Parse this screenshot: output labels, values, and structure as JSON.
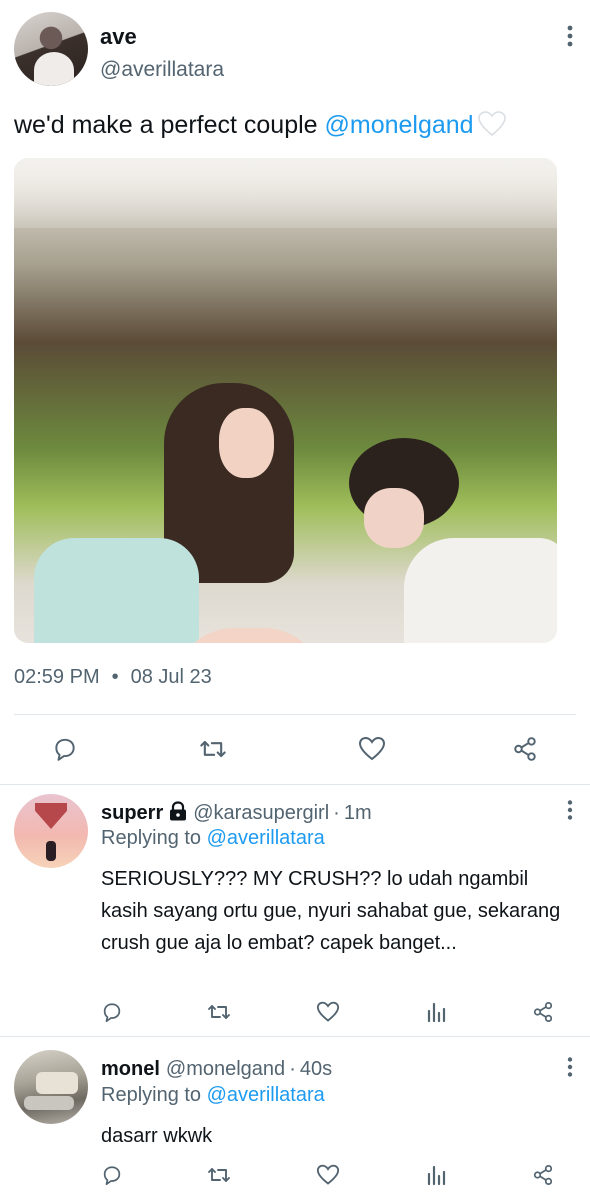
{
  "tweet": {
    "author_name": "ave",
    "author_handle": "@averillatara",
    "text": "we'd make a perfect couple ",
    "mention": "@monelgand",
    "time": "02:59 PM",
    "separator": "•",
    "date": "08 Jul 23",
    "icons": [
      "more-vertical-icon",
      "reply-icon",
      "retweet-icon",
      "like-icon",
      "share-icon"
    ]
  },
  "replies": [
    {
      "name": "superr",
      "handle": "@karasupergirl",
      "time": "1m",
      "meta_separator": "·",
      "replying_prefix": "Replying to ",
      "replying_to": "@averillatara",
      "text": "SERIOUSLY??? MY CRUSH?? lo udah ngambil kasih sayang ortu gue, nyuri sahabat gue, sekarang crush gue aja lo embat? capek banget...",
      "locked": true
    },
    {
      "name": "monel",
      "handle": "@monelgand",
      "time": "40s",
      "meta_separator": "·",
      "replying_prefix": "Replying to ",
      "replying_to": "@averillatara",
      "text": "dasarr wkwk",
      "locked": false
    }
  ],
  "colors": {
    "text": "#0f1419",
    "secondary": "#536471",
    "link": "#1d9bf0",
    "divider": "#e1e6ea"
  }
}
